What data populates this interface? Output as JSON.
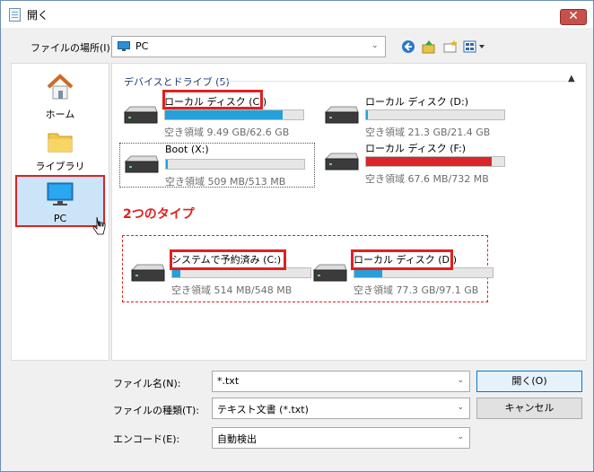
{
  "window": {
    "title": "開く",
    "close_glyph": "✕"
  },
  "location": {
    "label": "ファイルの場所(I):",
    "value": "PC"
  },
  "sidebar": {
    "items": [
      {
        "label": "ホーム"
      },
      {
        "label": "ライブラリ"
      },
      {
        "label": "PC"
      }
    ]
  },
  "main": {
    "section_title": "デバイスとドライブ (5)",
    "drives": [
      {
        "name": "ローカル ディスク (C:)",
        "free": "空き領域 9.49 GB/62.6 GB",
        "used_fraction": 0.85,
        "bar_color": "#26a0da"
      },
      {
        "name": "ローカル ディスク (D:)",
        "free": "空き領域 21.3 GB/21.4 GB",
        "used_fraction": 0.01,
        "bar_color": "#26a0da"
      },
      {
        "name": "Boot (X:)",
        "free": "空き領域 509 MB/513 MB",
        "used_fraction": 0.01,
        "bar_color": "#26a0da"
      },
      {
        "name": "ローカル ディスク (F:)",
        "free": "空き領域 67.6 MB/732 MB",
        "used_fraction": 0.91,
        "bar_color": "#da2626"
      },
      {
        "name": "システムで予約済み (C:)",
        "free": "空き領域 514 MB/548 MB",
        "used_fraction": 0.06,
        "bar_color": "#26a0da"
      },
      {
        "name": "ローカル ディスク (D:)",
        "free": "空き領域 77.3 GB/97.1 GB",
        "used_fraction": 0.2,
        "bar_color": "#26a0da"
      }
    ],
    "annotation": "2つのタイプ"
  },
  "form": {
    "filename_label": "ファイル名(N):",
    "filename_value": "*.txt",
    "filetype_label": "ファイルの種類(T):",
    "filetype_value": "テキスト文書 (*.txt)",
    "encoding_label": "エンコード(E):",
    "encoding_value": "自動検出",
    "open_button": "開く(O)",
    "cancel_button": "キャンセル"
  },
  "colors": {
    "accent": "#26a0da",
    "annotation": "#e02020",
    "section_title": "#1e3c7a"
  }
}
